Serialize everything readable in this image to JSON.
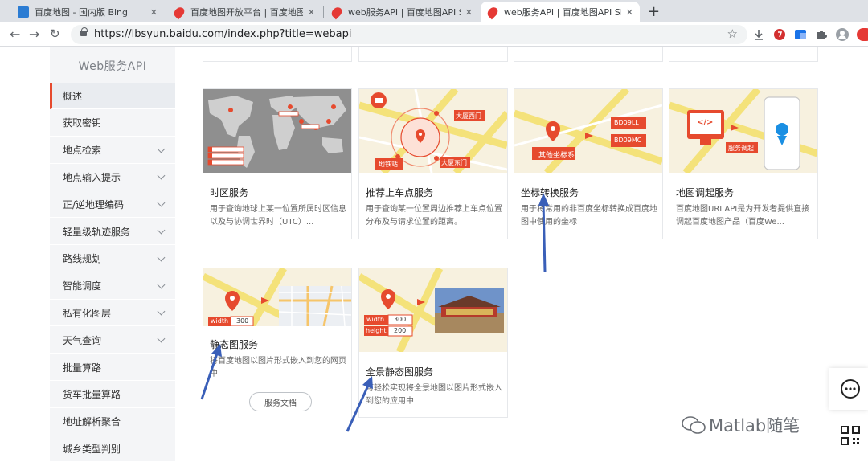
{
  "browser": {
    "tabs": [
      {
        "title": "百度地图 - 国内版 Bing",
        "favicon": "bing-icon"
      },
      {
        "title": "百度地图开放平台 | 百度地图API",
        "favicon": "baidu-map-icon"
      },
      {
        "title": "web服务API | 百度地图API SDK",
        "favicon": "baidu-map-icon"
      },
      {
        "title": "web服务API | 百度地图API SDK",
        "favicon": "baidu-map-icon",
        "active": true
      }
    ],
    "url": "https://lbsyun.baidu.com/index.php?title=webapi"
  },
  "sidebar": {
    "title": "Web服务API",
    "items": [
      {
        "label": "概述",
        "active": true
      },
      {
        "label": "获取密钥"
      },
      {
        "label": "地点检索",
        "expandable": true
      },
      {
        "label": "地点输入提示",
        "expandable": true
      },
      {
        "label": "正/逆地理编码",
        "expandable": true
      },
      {
        "label": "轻量级轨迹服务",
        "expandable": true
      },
      {
        "label": "路线规划",
        "expandable": true
      },
      {
        "label": "智能调度",
        "expandable": true
      },
      {
        "label": "私有化图层",
        "expandable": true
      },
      {
        "label": "天气查询",
        "expandable": true
      },
      {
        "label": "批量算路"
      },
      {
        "label": "货车批量算路"
      },
      {
        "label": "地址解析聚合"
      },
      {
        "label": "城乡类型判别"
      }
    ]
  },
  "cards": [
    {
      "title": "时区服务",
      "desc": "用于查询地球上某一位置所属时区信息以及与协调世界时（UTC）..."
    },
    {
      "title": "推荐上车点服务",
      "desc": "用于查询某一位置周边推荐上车点位置分布及与请求位置的距离。",
      "thumb": {
        "label_a": "大厦西门",
        "label_b": "地铁站",
        "label_c": "大厦东门"
      }
    },
    {
      "title": "坐标转换服务",
      "desc": "用于将常用的非百度坐标转换成百度地图中使用的坐标",
      "thumb": {
        "label_a": "BD09LL",
        "label_b": "BD09MC",
        "label_c": "其他坐标系"
      }
    },
    {
      "title": "地图调起服务",
      "desc": "百度地图URI API是为开发者提供直接调起百度地图产品（百度We...",
      "thumb": {
        "label_a": "服务调起",
        "code": "</>"
      }
    },
    {
      "title": "静态图服务",
      "desc": "将百度地图以图片形式嵌入到您的网页中",
      "button": "服务文档",
      "thumb": {
        "k_width": "width",
        "v_width": "300"
      }
    },
    {
      "title": "全景静态图服务",
      "desc": "可轻松实现将全景地图以图片形式嵌入到您的应用中",
      "thumb": {
        "k_width": "width",
        "v_width": "300",
        "k_height": "height",
        "v_height": "200"
      }
    }
  ],
  "watermark": "Matlab随笔",
  "colors": {
    "accent": "#e64a2e",
    "annotation_arrow": "#3a5fb8",
    "map_yellow": "#f4e27a"
  }
}
